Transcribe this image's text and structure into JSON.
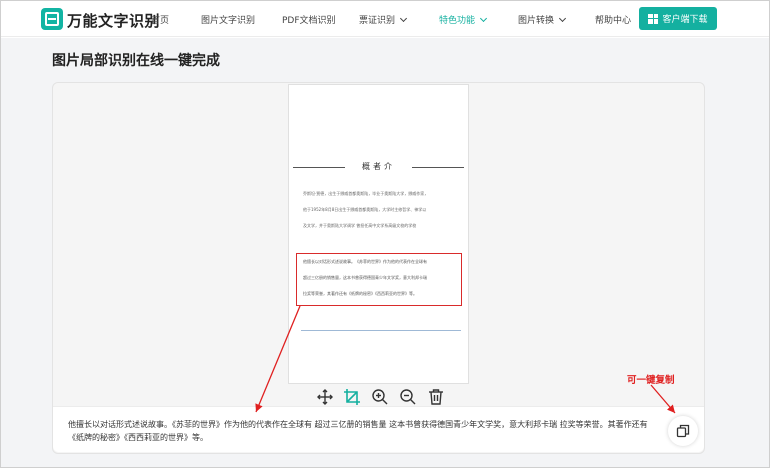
{
  "header": {
    "logo_text": "万能文字识别",
    "nav": [
      {
        "label": "首页",
        "active": false
      },
      {
        "label": "图片文字识别",
        "active": false
      },
      {
        "label": "PDF文档识别",
        "active": false
      },
      {
        "label": "票证识别",
        "active": false,
        "dropdown": true
      },
      {
        "label": "特色功能",
        "active": true,
        "dropdown": true
      },
      {
        "label": "图片转换",
        "active": false,
        "dropdown": true
      },
      {
        "label": "帮助中心",
        "active": false
      }
    ],
    "download_label": "客户端下载"
  },
  "page": {
    "title": "图片局部识别在线一键完成"
  },
  "document": {
    "heading": "概者介",
    "intro_lines": [
      "乔斯坦·贾德，出生于挪威首都奥斯陆，毕业于奥斯陆大学，挪威作家，",
      "他于1952年8月8日出生于挪威首都奥斯陆，大学时主修哲学、神学以",
      "及文学，并于奥斯陆大学调学 曾担任高中文学系高级文校的学校"
    ],
    "selected_lines": [
      "他擅长以对话形式述说故事。《苏菲的世界》作为他的代表作在全球有",
      "超过三亿册的销售量，这本书曾获得德国青少年文学奖，意大利邦卡瑞",
      "拉奖等荣誉，其著作还有《纸牌的秘密》《西西莉亚的世界》等。"
    ]
  },
  "toolbar": {
    "icons": [
      "move-icon",
      "crop-icon",
      "zoom-in-icon",
      "zoom-out-icon",
      "delete-icon"
    ]
  },
  "result": {
    "lines": [
      "他擅长以对话形式述说故事。《苏菲的世界》作为他的代表作在全球有 超过三亿册的销售量 这本书曾获得德国青少年文学奖，意大利邦卡瑞 拉奖等荣誉。其著作还有",
      "《纸牌的秘密》《西西莉亚的世界》等。"
    ]
  },
  "annotation": {
    "copy_hint": "可一键复制"
  },
  "colors": {
    "accent": "#14b0a0",
    "annotation_red": "#e02020"
  }
}
